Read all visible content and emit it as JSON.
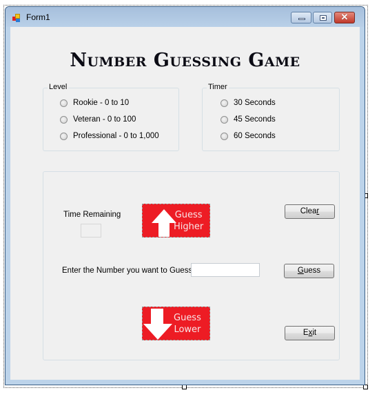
{
  "window": {
    "title": "Form1",
    "icon": "winforms-app-icon",
    "controls": {
      "minimize": "minimize-icon",
      "maximize": "maximize-icon",
      "close": "close-icon"
    }
  },
  "heading": "Number Guessing Game",
  "level_group": {
    "label": "Level",
    "options": [
      {
        "label": "Rookie - 0 to 10",
        "checked": false
      },
      {
        "label": "Veteran - 0 to 100",
        "checked": false
      },
      {
        "label": "Professional - 0 to 1,000",
        "checked": false
      }
    ]
  },
  "timer_group": {
    "label": "Timer",
    "options": [
      {
        "label": "30 Seconds",
        "checked": false
      },
      {
        "label": "45 Seconds",
        "checked": false
      },
      {
        "label": "60 Seconds",
        "checked": false
      }
    ]
  },
  "game_panel": {
    "time_remaining_label": "Time Remaining",
    "time_remaining_value": "",
    "guess_higher": {
      "line1": "Guess",
      "line2": "Higher",
      "icon": "arrow-up-icon",
      "color": "#ed1c24"
    },
    "guess_lower": {
      "line1": "Guess",
      "line2": "Lower",
      "icon": "arrow-down-icon",
      "color": "#ed1c24"
    },
    "enter_number_label": "Enter the Number you want to Guess:",
    "guess_input_value": "",
    "buttons": {
      "clear": {
        "before": "Clea",
        "mnemonic": "r",
        "after": ""
      },
      "guess": {
        "before": "",
        "mnemonic": "G",
        "after": "uess"
      },
      "exit": {
        "before": "E",
        "mnemonic": "x",
        "after": "it"
      }
    }
  }
}
